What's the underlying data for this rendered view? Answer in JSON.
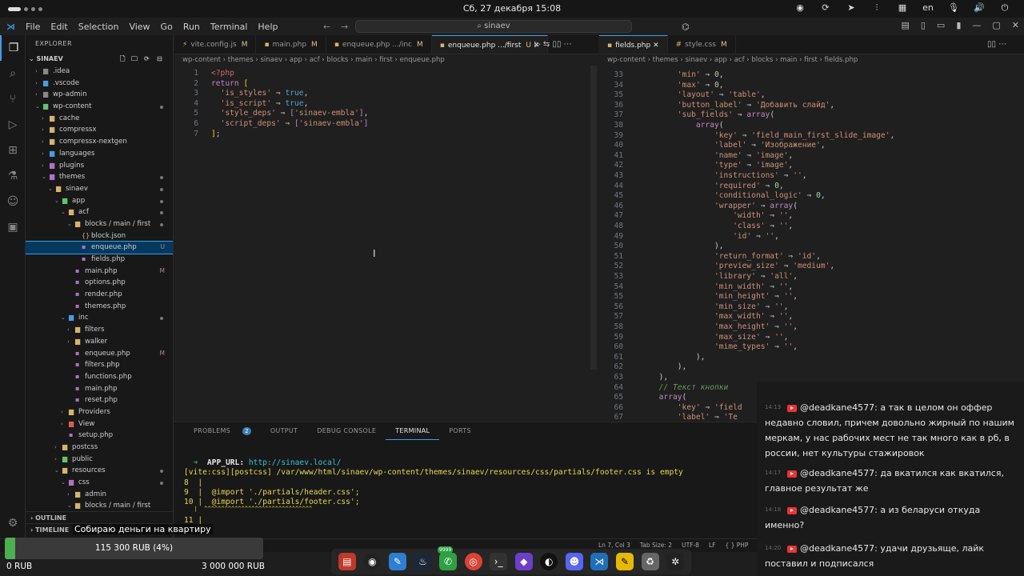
{
  "system": {
    "datetime": "Сб, 27 декабря 15:08",
    "lang": "en"
  },
  "window": {
    "menu": [
      "File",
      "Edit",
      "Selection",
      "View",
      "Go",
      "Run",
      "Terminal",
      "Help"
    ],
    "search": "sinaev"
  },
  "explorer": {
    "header": "EXPLORER",
    "root": "SINAEV",
    "items": [
      {
        "name": ".idea",
        "depth": 1,
        "type": "folder",
        "open": false,
        "cls": "fgray"
      },
      {
        "name": ".vscode",
        "depth": 1,
        "type": "folder",
        "open": false,
        "cls": "fb"
      },
      {
        "name": "wp-admin",
        "depth": 1,
        "type": "folder",
        "open": false,
        "cls": "fgray"
      },
      {
        "name": "wp-content",
        "depth": 1,
        "type": "folder",
        "open": true,
        "cls": "fg",
        "dot": true
      },
      {
        "name": "cache",
        "depth": 2,
        "type": "folder",
        "open": false,
        "cls": "fy"
      },
      {
        "name": "compressx",
        "depth": 2,
        "type": "folder",
        "open": false,
        "cls": "fy"
      },
      {
        "name": "compressx-nextgen",
        "depth": 2,
        "type": "folder",
        "open": false,
        "cls": "fy"
      },
      {
        "name": "languages",
        "depth": 2,
        "type": "folder",
        "open": false,
        "cls": "fb"
      },
      {
        "name": "plugins",
        "depth": 2,
        "type": "folder",
        "open": false,
        "cls": "fp"
      },
      {
        "name": "themes",
        "depth": 2,
        "type": "folder",
        "open": true,
        "cls": "fp",
        "dot": true
      },
      {
        "name": "sinaev",
        "depth": 3,
        "type": "folder",
        "open": true,
        "cls": "fy",
        "dot": true
      },
      {
        "name": "app",
        "depth": 4,
        "type": "folder",
        "open": true,
        "cls": "fg",
        "dot": true
      },
      {
        "name": "acf",
        "depth": 5,
        "type": "folder",
        "open": true,
        "cls": "fy",
        "dot": true
      },
      {
        "name": "blocks / main / first",
        "depth": 6,
        "type": "folder",
        "open": true,
        "cls": "fy",
        "dot": true
      },
      {
        "name": "block.json",
        "depth": 7,
        "type": "json",
        "cls": "fy"
      },
      {
        "name": "enqueue.php",
        "depth": 7,
        "type": "php",
        "cls": "fp",
        "badge": "U",
        "selected": true
      },
      {
        "name": "fields.php",
        "depth": 7,
        "type": "php",
        "cls": "fp"
      },
      {
        "name": "main.php",
        "depth": 6,
        "type": "php",
        "cls": "fp",
        "badge": "M"
      },
      {
        "name": "options.php",
        "depth": 6,
        "type": "php",
        "cls": "fp"
      },
      {
        "name": "render.php",
        "depth": 6,
        "type": "php",
        "cls": "fp"
      },
      {
        "name": "themes.php",
        "depth": 6,
        "type": "php",
        "cls": "fp"
      },
      {
        "name": "inc",
        "depth": 5,
        "type": "folder",
        "open": true,
        "cls": "fb",
        "dot": true
      },
      {
        "name": "filters",
        "depth": 6,
        "type": "folder",
        "open": false,
        "cls": "fy"
      },
      {
        "name": "walker",
        "depth": 6,
        "type": "folder",
        "open": false,
        "cls": "fy"
      },
      {
        "name": "enqueue.php",
        "depth": 6,
        "type": "php",
        "cls": "fp",
        "badge": "M"
      },
      {
        "name": "filters.php",
        "depth": 6,
        "type": "php",
        "cls": "fp"
      },
      {
        "name": "functions.php",
        "depth": 6,
        "type": "php",
        "cls": "fp"
      },
      {
        "name": "main.php",
        "depth": 6,
        "type": "php",
        "cls": "fp"
      },
      {
        "name": "reset.php",
        "depth": 6,
        "type": "php",
        "cls": "fp"
      },
      {
        "name": "Providers",
        "depth": 5,
        "type": "folder",
        "open": false,
        "cls": "fy"
      },
      {
        "name": "View",
        "depth": 5,
        "type": "folder",
        "open": false,
        "cls": "fr"
      },
      {
        "name": "setup.php",
        "depth": 5,
        "type": "php",
        "cls": "fp"
      },
      {
        "name": "postcss",
        "depth": 4,
        "type": "folder",
        "open": false,
        "cls": "fy"
      },
      {
        "name": "public",
        "depth": 4,
        "type": "folder",
        "open": false,
        "cls": "fg"
      },
      {
        "name": "resources",
        "depth": 4,
        "type": "folder",
        "open": true,
        "cls": "fy",
        "dot": true
      },
      {
        "name": "css",
        "depth": 5,
        "type": "folder",
        "open": true,
        "cls": "fp",
        "dot": true
      },
      {
        "name": "admin",
        "depth": 6,
        "type": "folder",
        "open": false,
        "cls": "fy"
      },
      {
        "name": "blocks / main / first",
        "depth": 6,
        "type": "folder",
        "open": true,
        "cls": "fy"
      }
    ],
    "outline": "OUTLINE",
    "timeline": "TIMELINE"
  },
  "tabs_left": [
    {
      "icon": "V",
      "label": "vite.config.js",
      "mark": "M",
      "active": false
    },
    {
      "icon": "php",
      "label": "main.php",
      "mark": "M",
      "active": false
    },
    {
      "icon": "php",
      "label": "enqueue.php",
      "path": ".../inc",
      "mark": "M",
      "active": false
    },
    {
      "icon": "php",
      "label": "enqueue.php",
      "path": ".../first",
      "mark": "U",
      "active": true
    }
  ],
  "tabs_right": [
    {
      "icon": "php",
      "label": "fields.php",
      "active": true
    },
    {
      "icon": "#",
      "label": "style.css",
      "mark": "M",
      "active": false
    }
  ],
  "breadcrumb_left": "wp-content › themes › sinaev › app › acf › blocks › main › first › enqueue.php",
  "breadcrumb_right": "wp-content › themes › sinaev › app › acf › blocks › main › first › fields.php",
  "panel": {
    "tabs": [
      "PROBLEMS",
      "OUTPUT",
      "DEBUG CONSOLE",
      "TERMINAL",
      "PORTS"
    ],
    "problems_count": "2",
    "app_url_label": "APP_URL:",
    "app_url": "http://sinaev.local/",
    "warn": "[vite:css][postcss] /var/www/html/sinaev/wp-content/themes/sinaev/resources/css/partials/footer.css is empty",
    "lines": [
      "8  |",
      "9  |  @import './partials/header.css';",
      "10 |  @import './partials/footer.css';",
      "   |  ^^^^^^^^^^^^^^^^^^^^^^^^^^^^^^^^",
      "11 |"
    ]
  },
  "status": {
    "pos": "Ln 7, Col 3",
    "tab": "Tab Size: 2",
    "enc": "UTF-8",
    "eol": "LF",
    "lang": "PHP"
  },
  "donation": {
    "title": "Собираю деньги на квартиру",
    "value_text": "115 300 RUB (4%)",
    "progress": 0.04,
    "min": "0 RUB",
    "max": "3 000 000 RUB"
  },
  "chat": [
    {
      "time": "14:13",
      "user": "@deadkane4577:",
      "text": " а так в целом он оффер недавно словил, причем довольно жирный по нашим меркам, у нас рабочих мест не так много как в рб, в россии, нет культуры стажировок"
    },
    {
      "time": "14:17",
      "user": "@deadkane4577:",
      "text": " да вкатился как вкатился, главное результат же"
    },
    {
      "time": "14:18",
      "user": "@deadkane4577:",
      "text": " а из беларуси откуда именно?"
    },
    {
      "time": "14:20",
      "user": "@deadkane4577:",
      "text": " удачи друзьяще, лайк поставил и подписался"
    }
  ],
  "dock_badge": "9999"
}
